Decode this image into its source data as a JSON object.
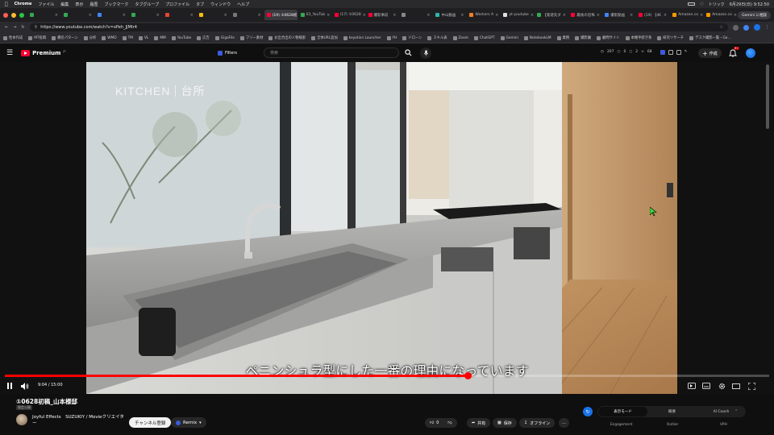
{
  "menubar": {
    "app": "Chrome",
    "items": [
      "ファイル",
      "編集",
      "表示",
      "履歴",
      "ブックマーク",
      "タブグループ",
      "プロファイル",
      "タブ",
      "ウィンドウ",
      "ヘルプ"
    ],
    "clock": "6月29日(日) 9:52:50",
    "user_label": "トリック"
  },
  "tabs": [
    {
      "label": "",
      "color": "#34a853"
    },
    {
      "label": "",
      "color": "#34a853"
    },
    {
      "label": "",
      "color": "#4285f4"
    },
    {
      "label": "",
      "color": "#34a853"
    },
    {
      "label": "",
      "color": "#ea4335"
    },
    {
      "label": "",
      "color": "#fbbc05"
    },
    {
      "label": "",
      "color": "#777777"
    },
    {
      "label": "(19) ①0628初",
      "color": "#ff0033",
      "active": true
    },
    {
      "label": "03_YouTub",
      "color": "#34a853"
    },
    {
      "label": "(17) ①0628",
      "color": "#ff0033"
    },
    {
      "label": "撮影事前",
      "color": "#ff0033"
    },
    {
      "label": "",
      "color": "#888888"
    },
    {
      "label": "中山動画",
      "color": "#2bb5a8"
    },
    {
      "label": "Workers A",
      "color": "#f38020"
    },
    {
      "label": "yt-youtube",
      "color": "#dddddd"
    },
    {
      "label": "【発達先ダ",
      "color": "#34a853"
    },
    {
      "label": "最後の恐怖",
      "color": "#ff0033"
    },
    {
      "label": "撮影動画",
      "color": "#4285f4"
    },
    {
      "label": "(19) 【4K",
      "color": "#ff0033"
    },
    {
      "label": "Amazon.co",
      "color": "#ff9900"
    },
    {
      "label": "Amazon.co",
      "color": "#ff9900"
    }
  ],
  "gemini_button": "Gemini に相談",
  "address": {
    "url": "https://www.youtube.com/watch?v=xPeh_JJMtr4"
  },
  "bookmarks": [
    "性本作成",
    "MT投稿",
    "橋名パターン",
    "分析",
    "WMO",
    "TM",
    "VL",
    "MM",
    "YouTube",
    "広告",
    "GigaFile",
    "フリー素材",
    "お出合出の人物検索",
    "全体URL追加",
    "keyotion Launcher",
    "YH",
    "ドローン",
    "スキル表",
    "Zoom",
    "ChatGPT",
    "Gemini",
    "NotebookLM",
    "業務",
    "撮影園",
    "顧問サイト",
    "本棚手続き系",
    "研究リサーチ",
    "デスク撮影一覧・Go..."
  ],
  "ytheader": {
    "logo_text": "Premium",
    "logo_sup": "JP",
    "filters_label": "Filters",
    "search_placeholder": "検索",
    "stats": [
      "207",
      "0",
      "2",
      "68"
    ],
    "create_label": "作成",
    "notif_count": "9+"
  },
  "video": {
    "title_left": "KITCHEN",
    "title_right": "台所",
    "subtitle": "ペニンシュラ型にした一番の理由になっています",
    "time": "9:04 / 15:00",
    "progress_fraction": 0.605
  },
  "below": {
    "video_title": "①0628初稿_山本様邸",
    "visibility_badge": "限定公開",
    "channel_name": "Joyful Effects　SUZUKIY / Movieクリエイター",
    "subscribe": "チャンネル登録",
    "remix": "Remix",
    "like_count": "0",
    "share": "共有",
    "save": "保存",
    "offline": "オフライン",
    "more": "…",
    "panel_tabs": [
      "表示モード",
      "概要",
      "AI Coach"
    ],
    "panel_cols": [
      "Engagement",
      "Outlier",
      "VPH"
    ]
  },
  "colors": {
    "yt_red": "#ff0033",
    "progress": "#ff0000",
    "subscribe_bg": "#f1f1f1"
  }
}
